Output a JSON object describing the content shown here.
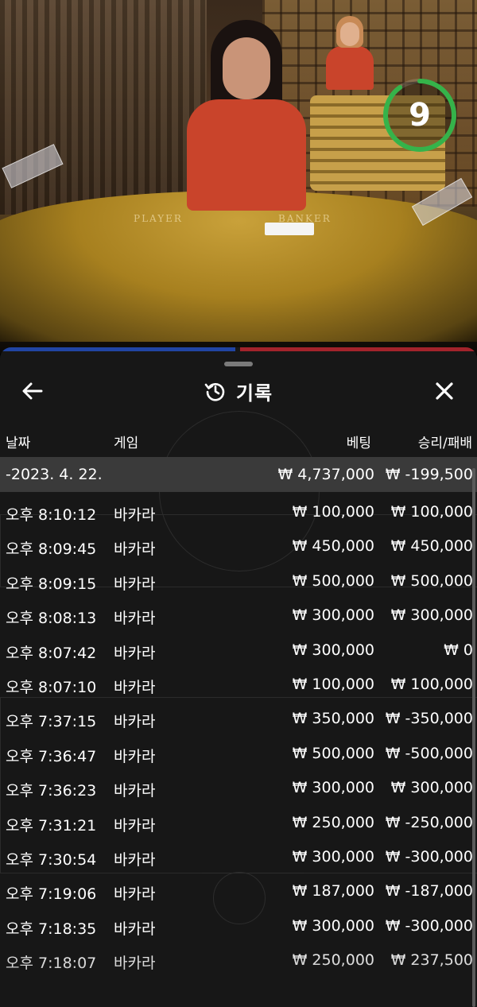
{
  "timer": {
    "value": "9",
    "remaining_fraction": 0.9,
    "color": "#35b34a"
  },
  "table_labels": {
    "player": "PLAYER",
    "banker": "BANKER"
  },
  "header": {
    "title": "기록",
    "back_icon": "arrow-left-icon",
    "history_icon": "history-icon",
    "close_icon": "close-icon"
  },
  "columns": {
    "date": "날짜",
    "game": "게임",
    "bet": "베팅",
    "result": "승리/패배"
  },
  "summary": {
    "date": "-2023. 4. 22.",
    "bet": "₩ 4,737,000",
    "result": "₩ -199,500"
  },
  "rows": [
    {
      "time": "오후 8:10:12",
      "game": "바카라",
      "bet": "₩ 100,000",
      "result": "₩ 100,000"
    },
    {
      "time": "오후 8:09:45",
      "game": "바카라",
      "bet": "₩ 450,000",
      "result": "₩ 450,000"
    },
    {
      "time": "오후 8:09:15",
      "game": "바카라",
      "bet": "₩ 500,000",
      "result": "₩ 500,000"
    },
    {
      "time": "오후 8:08:13",
      "game": "바카라",
      "bet": "₩ 300,000",
      "result": "₩ 300,000"
    },
    {
      "time": "오후 8:07:42",
      "game": "바카라",
      "bet": "₩ 300,000",
      "result": "₩ 0"
    },
    {
      "time": "오후 8:07:10",
      "game": "바카라",
      "bet": "₩ 100,000",
      "result": "₩ 100,000"
    },
    {
      "time": "오후 7:37:15",
      "game": "바카라",
      "bet": "₩ 350,000",
      "result": "₩ -350,000"
    },
    {
      "time": "오후 7:36:47",
      "game": "바카라",
      "bet": "₩ 500,000",
      "result": "₩ -500,000"
    },
    {
      "time": "오후 7:36:23",
      "game": "바카라",
      "bet": "₩ 300,000",
      "result": "₩ 300,000"
    },
    {
      "time": "오후 7:31:21",
      "game": "바카라",
      "bet": "₩ 250,000",
      "result": "₩ -250,000"
    },
    {
      "time": "오후 7:30:54",
      "game": "바카라",
      "bet": "₩ 300,000",
      "result": "₩ -300,000"
    },
    {
      "time": "오후 7:19:06",
      "game": "바카라",
      "bet": "₩ 187,000",
      "result": "₩ -187,000"
    },
    {
      "time": "오후 7:18:35",
      "game": "바카라",
      "bet": "₩ 300,000",
      "result": "₩ -300,000"
    },
    {
      "time": "오후 7:18:07",
      "game": "바카라",
      "bet": "₩ 250,000",
      "result": "₩ 237,500"
    }
  ]
}
